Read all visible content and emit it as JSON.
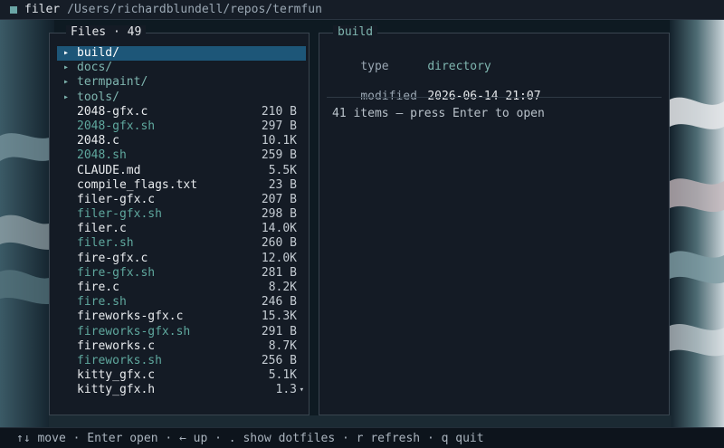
{
  "titlebar": {
    "app": "filer",
    "path": "/Users/richardblundell/repos/termfun"
  },
  "files_panel": {
    "title": "Files · 49",
    "items": [
      {
        "name": "build/",
        "size": "",
        "kind": "dir",
        "selected": true
      },
      {
        "name": "docs/",
        "size": "",
        "kind": "dir"
      },
      {
        "name": "termpaint/",
        "size": "",
        "kind": "dir"
      },
      {
        "name": "tools/",
        "size": "",
        "kind": "dir"
      },
      {
        "name": "2048-gfx.c",
        "size": "210 B",
        "kind": "file"
      },
      {
        "name": "2048-gfx.sh",
        "size": "297 B",
        "kind": "sh"
      },
      {
        "name": "2048.c",
        "size": "10.1K",
        "kind": "file"
      },
      {
        "name": "2048.sh",
        "size": "259 B",
        "kind": "sh"
      },
      {
        "name": "CLAUDE.md",
        "size": "5.5K",
        "kind": "file"
      },
      {
        "name": "compile_flags.txt",
        "size": "23 B",
        "kind": "file"
      },
      {
        "name": "filer-gfx.c",
        "size": "207 B",
        "kind": "file"
      },
      {
        "name": "filer-gfx.sh",
        "size": "298 B",
        "kind": "sh"
      },
      {
        "name": "filer.c",
        "size": "14.0K",
        "kind": "file"
      },
      {
        "name": "filer.sh",
        "size": "260 B",
        "kind": "sh"
      },
      {
        "name": "fire-gfx.c",
        "size": "12.0K",
        "kind": "file"
      },
      {
        "name": "fire-gfx.sh",
        "size": "281 B",
        "kind": "sh"
      },
      {
        "name": "fire.c",
        "size": "8.2K",
        "kind": "file"
      },
      {
        "name": "fire.sh",
        "size": "246 B",
        "kind": "sh"
      },
      {
        "name": "fireworks-gfx.c",
        "size": "15.3K",
        "kind": "file"
      },
      {
        "name": "fireworks-gfx.sh",
        "size": "291 B",
        "kind": "sh"
      },
      {
        "name": "fireworks.c",
        "size": "8.7K",
        "kind": "file"
      },
      {
        "name": "fireworks.sh",
        "size": "256 B",
        "kind": "sh"
      },
      {
        "name": "kitty_gfx.c",
        "size": "5.1K",
        "kind": "file"
      },
      {
        "name": "kitty_gfx.h",
        "size": "1.3",
        "kind": "file"
      }
    ],
    "dir_marker": "▸",
    "scroll_marker": "▾"
  },
  "detail_panel": {
    "title": "build",
    "type_label": "type",
    "type_value": "directory",
    "modified_label": "modified",
    "modified_value": "2026-06-14 21:07",
    "message": "41 items — press Enter to open"
  },
  "statusbar": {
    "hints": "↑↓ move · Enter open · ← up · . show dotfiles · r refresh · q quit"
  },
  "colors": {
    "selection": "#1d5678",
    "accent": "#7fb6b0",
    "script": "#5fa89e"
  }
}
